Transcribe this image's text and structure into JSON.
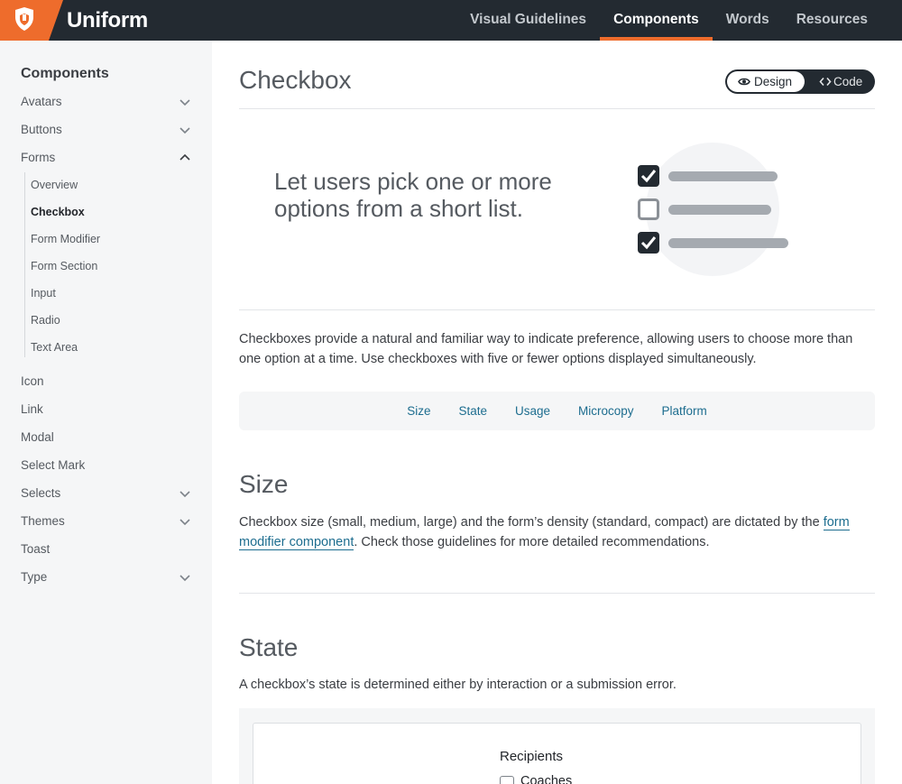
{
  "header": {
    "brand": "Uniform",
    "nav": [
      {
        "label": "Visual Guidelines",
        "active": false
      },
      {
        "label": "Components",
        "active": true
      },
      {
        "label": "Words",
        "active": false
      },
      {
        "label": "Resources",
        "active": false
      }
    ],
    "accent_color": "#ee6c2c"
  },
  "sidebar": {
    "title": "Components",
    "items": [
      {
        "label": "Avatars",
        "chevron": "down"
      },
      {
        "label": "Buttons",
        "chevron": "down"
      },
      {
        "label": "Forms",
        "chevron": "up"
      },
      {
        "label": "Icon"
      },
      {
        "label": "Link"
      },
      {
        "label": "Modal"
      },
      {
        "label": "Select Mark"
      },
      {
        "label": "Selects",
        "chevron": "down"
      },
      {
        "label": "Themes",
        "chevron": "down"
      },
      {
        "label": "Toast"
      },
      {
        "label": "Type",
        "chevron": "down"
      }
    ],
    "forms_children": [
      {
        "label": "Overview"
      },
      {
        "label": "Checkbox",
        "active": true
      },
      {
        "label": "Form Modifier"
      },
      {
        "label": "Form Section"
      },
      {
        "label": "Input"
      },
      {
        "label": "Radio"
      },
      {
        "label": "Text Area"
      }
    ]
  },
  "main": {
    "title": "Checkbox",
    "toggle": {
      "design": "Design",
      "code": "Code",
      "selected": "Design"
    },
    "hero_text": "Let users pick one or more options from a short list.",
    "intro": "Checkboxes provide a natural and familiar way to indicate preference, allowing users to choose more than one option at a time. Use checkboxes with five or fewer options displayed simultaneously.",
    "toc": [
      "Size",
      "State",
      "Usage",
      "Microcopy",
      "Platform"
    ],
    "size": {
      "heading": "Size",
      "text_before": "Checkbox size (small, medium, large) and the form’s density (standard, compact) are dictated by the ",
      "link": "form modifier component",
      "text_after": ". Check those guidelines for more detailed recommendations."
    },
    "state": {
      "heading": "State",
      "text": "A checkbox’s state is determined either by interaction or a submission error.",
      "demo_label": "Recipients",
      "demo_option": "Coaches"
    }
  }
}
